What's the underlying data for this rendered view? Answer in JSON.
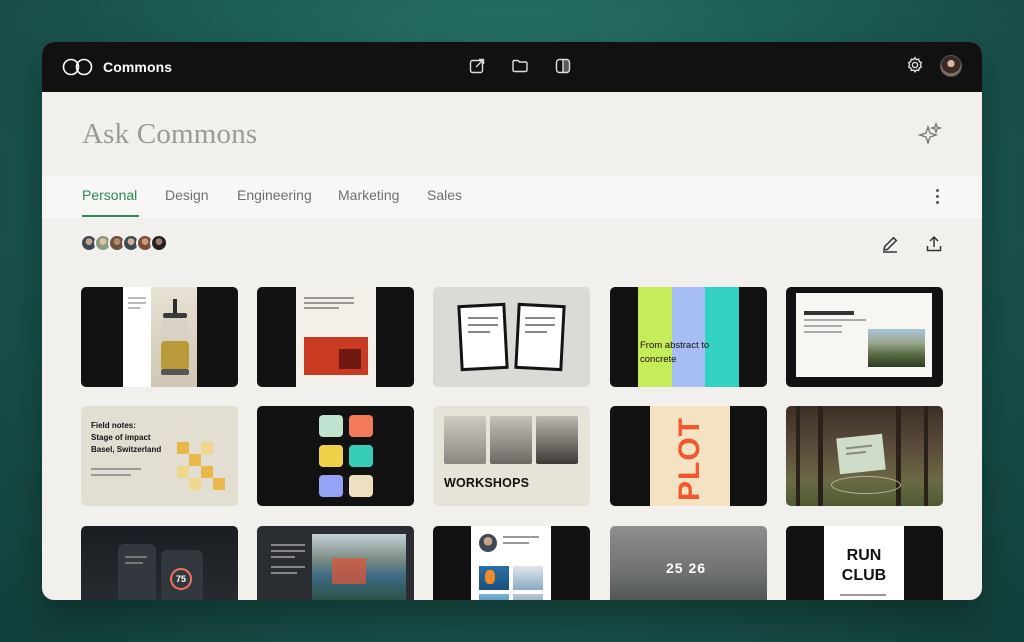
{
  "app": {
    "title": "Commons"
  },
  "ask": {
    "placeholder": "Ask Commons"
  },
  "tabs": [
    {
      "label": "Personal",
      "active": true
    },
    {
      "label": "Design",
      "active": false
    },
    {
      "label": "Engineering",
      "active": false
    },
    {
      "label": "Marketing",
      "active": false
    },
    {
      "label": "Sales",
      "active": false
    }
  ],
  "icons": {
    "logo": "two-rings-logo",
    "toolbar_center": [
      "external-link-icon",
      "folder-icon",
      "split-view-icon"
    ],
    "toolbar_right": [
      "gear-icon",
      "avatar"
    ],
    "ask": "sparkle-icon",
    "tabs_menu": "more-vertical-icon",
    "actions": [
      "edit-icon",
      "share-icon"
    ]
  },
  "collaborators_count": 6,
  "cards": {
    "from_abstract": "From abstract to concrete",
    "field_notes": [
      "Field notes:",
      "Stage of impact",
      "Basel, Switzerland"
    ],
    "workshops": "WORKSHOPS",
    "plot": "PLOT",
    "score": "25 26",
    "gauge": "75",
    "run_club": "RUN CLUB"
  },
  "colors": {
    "accent_green": "#2c8a55",
    "titlebar": "#111111",
    "canvas": "#f1f0ed"
  }
}
